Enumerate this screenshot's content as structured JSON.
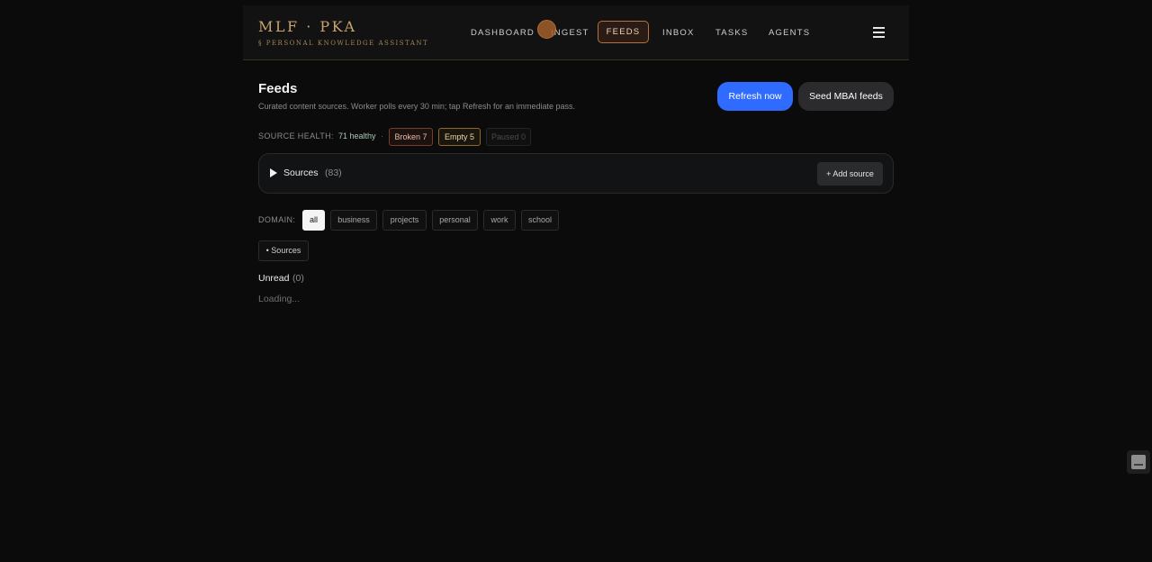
{
  "brand": {
    "title": "MLF · PKA",
    "subtitle": "§ PERSONAL KNOWLEDGE ASSISTANT"
  },
  "nav": {
    "items": [
      {
        "label": "DASHBOARD"
      },
      {
        "label": "INGEST"
      },
      {
        "label": "FEEDS",
        "active": true
      },
      {
        "label": "INBOX"
      },
      {
        "label": "TASKS"
      },
      {
        "label": "AGENTS"
      }
    ],
    "menu_icon": "hamburger-menu-icon"
  },
  "page": {
    "title": "Feeds",
    "description": "Curated content sources. Worker polls every 30 min; tap Refresh for an immediate pass.",
    "refresh_label": "Refresh now",
    "seed_label": "Seed MBAI feeds"
  },
  "health": {
    "label": "SOURCE HEALTH:",
    "healthy": "71 healthy",
    "separator": "·",
    "broken": "Broken 7",
    "empty": "Empty 5",
    "paused": "Paused 0"
  },
  "sources": {
    "label": "Sources",
    "count": "(83)",
    "add_label": "+ Add source"
  },
  "domain": {
    "label": "DOMAIN:",
    "filters": [
      "all",
      "business",
      "projects",
      "personal",
      "work",
      "school"
    ],
    "selected": "all"
  },
  "toggle_sources_label": "• Sources",
  "unread": {
    "label": "Unread",
    "count": "(0)"
  },
  "loading_text": "Loading...",
  "colors": {
    "background": "#0b0b0c",
    "accent_gold": "#c9a36b",
    "primary_blue": "#2f6bff",
    "active_nav_border": "#b5713f"
  }
}
